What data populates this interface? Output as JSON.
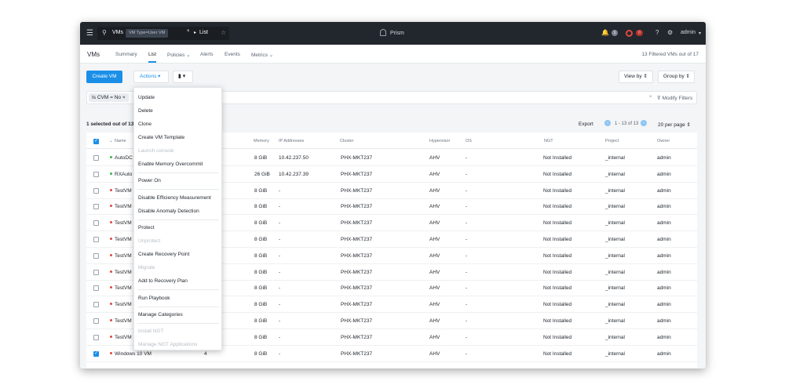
{
  "topbar": {
    "menu_icon": "hamburger-icon",
    "search_scope": "VMs",
    "search_tag": "VM Type=User VM",
    "search_tag_close": "×",
    "search_arrow": "▸",
    "search_view": "List",
    "brand": "Prism",
    "alerts_count": "1",
    "tasks_count": "0",
    "help": "?",
    "user": "admin"
  },
  "subnav": {
    "title": "VMs",
    "tabs": [
      {
        "label": "Summary"
      },
      {
        "label": "List"
      },
      {
        "label": "Policies ⌄"
      },
      {
        "label": "Alerts"
      },
      {
        "label": "Events"
      },
      {
        "label": "Metrics ⌄"
      }
    ],
    "filtered_text": "13 Filtered VMs out of 17"
  },
  "toolbar": {
    "create": "Create VM",
    "actions": "Actions ▾",
    "bookmark": "▮ ▾",
    "view_by": "View by ⇕",
    "group_by": "Group by ⇕"
  },
  "filter": {
    "chip": "Is CVM = No  ×",
    "clear": "×",
    "modify": "⊽ Modify Filters"
  },
  "summary": {
    "selected": "1 selected out of 13",
    "export": "Export",
    "pager_prev": "‹",
    "range": "1 - 13 of 13",
    "pager_next": "›",
    "per_page": "20 per page ⇕"
  },
  "columns": {
    "name": "Name",
    "memory": "Memory",
    "ip": "IP Addresses",
    "cluster": "Cluster",
    "hypervisor": "Hypervisor",
    "os": "OS",
    "ngt": "NGT",
    "project": "Project",
    "owner": "Owner"
  },
  "rows": [
    {
      "name": "AutoDC",
      "status": "on",
      "vcpu": "",
      "memory": "8 GiB",
      "ip": "10.42.237.50",
      "cluster": "PHX-MKT237",
      "hypervisor": "AHV",
      "os": "-",
      "ngt": "Not Installed",
      "project": "_internal",
      "owner": "admin",
      "checked": false
    },
    {
      "name": "RXAuto",
      "status": "on",
      "vcpu": "",
      "memory": "26 GiB",
      "ip": "10.42.237.39",
      "cluster": "PHX-MKT237",
      "hypervisor": "AHV",
      "os": "-",
      "ngt": "Not Installed",
      "project": "_internal",
      "owner": "admin",
      "checked": false
    },
    {
      "name": "TestVM",
      "status": "off",
      "vcpu": "",
      "memory": "8 GiB",
      "ip": "-",
      "cluster": "PHX-MKT237",
      "hypervisor": "AHV",
      "os": "-",
      "ngt": "Not Installed",
      "project": "_internal",
      "owner": "admin",
      "checked": false
    },
    {
      "name": "TestVM",
      "status": "off",
      "vcpu": "",
      "memory": "8 GiB",
      "ip": "-",
      "cluster": "PHX-MKT237",
      "hypervisor": "AHV",
      "os": "-",
      "ngt": "Not Installed",
      "project": "_internal",
      "owner": "admin",
      "checked": false
    },
    {
      "name": "TestVM",
      "status": "off",
      "vcpu": "",
      "memory": "8 GiB",
      "ip": "-",
      "cluster": "PHX-MKT237",
      "hypervisor": "AHV",
      "os": "-",
      "ngt": "Not Installed",
      "project": "_internal",
      "owner": "admin",
      "checked": false
    },
    {
      "name": "TestVM",
      "status": "off",
      "vcpu": "",
      "memory": "8 GiB",
      "ip": "-",
      "cluster": "PHX-MKT237",
      "hypervisor": "AHV",
      "os": "-",
      "ngt": "Not Installed",
      "project": "_internal",
      "owner": "admin",
      "checked": false
    },
    {
      "name": "TestVM",
      "status": "off",
      "vcpu": "",
      "memory": "8 GiB",
      "ip": "-",
      "cluster": "PHX-MKT237",
      "hypervisor": "AHV",
      "os": "-",
      "ngt": "Not Installed",
      "project": "_internal",
      "owner": "admin",
      "checked": false
    },
    {
      "name": "TestVM",
      "status": "off",
      "vcpu": "",
      "memory": "8 GiB",
      "ip": "-",
      "cluster": "PHX-MKT237",
      "hypervisor": "AHV",
      "os": "-",
      "ngt": "Not Installed",
      "project": "_internal",
      "owner": "admin",
      "checked": false
    },
    {
      "name": "TestVM",
      "status": "off",
      "vcpu": "",
      "memory": "8 GiB",
      "ip": "-",
      "cluster": "PHX-MKT237",
      "hypervisor": "AHV",
      "os": "-",
      "ngt": "Not Installed",
      "project": "_internal",
      "owner": "admin",
      "checked": false
    },
    {
      "name": "TestVM",
      "status": "off",
      "vcpu": "",
      "memory": "8 GiB",
      "ip": "-",
      "cluster": "PHX-MKT237",
      "hypervisor": "AHV",
      "os": "-",
      "ngt": "Not Installed",
      "project": "_internal",
      "owner": "admin",
      "checked": false
    },
    {
      "name": "TestVM",
      "status": "off",
      "vcpu": "",
      "memory": "8 GiB",
      "ip": "-",
      "cluster": "PHX-MKT237",
      "hypervisor": "AHV",
      "os": "-",
      "ngt": "Not Installed",
      "project": "_internal",
      "owner": "admin",
      "checked": false
    },
    {
      "name": "TestVM",
      "status": "off",
      "vcpu": "",
      "memory": "8 GiB",
      "ip": "-",
      "cluster": "PHX-MKT237",
      "hypervisor": "AHV",
      "os": "-",
      "ngt": "Not Installed",
      "project": "_internal",
      "owner": "admin",
      "checked": false
    },
    {
      "name": "Windows 10 VM",
      "status": "off",
      "vcpu": "4",
      "memory": "8 GiB",
      "ip": "-",
      "cluster": "PHX-MKT237",
      "hypervisor": "AHV",
      "os": "-",
      "ngt": "Not Installed",
      "project": "_internal",
      "owner": "admin",
      "checked": true
    }
  ],
  "actions_menu": [
    {
      "label": "Update",
      "disabled": false
    },
    {
      "label": "Delete",
      "disabled": false
    },
    {
      "label": "Clone",
      "disabled": false
    },
    {
      "label": "Create VM Template",
      "disabled": false
    },
    {
      "label": "Launch console",
      "disabled": true
    },
    {
      "label": "Enable Memory Overcommit",
      "disabled": false,
      "sep_after": true
    },
    {
      "label": "Power On",
      "disabled": false,
      "sep_after": true
    },
    {
      "label": "Disable Efficiency Measurement",
      "disabled": false
    },
    {
      "label": "Disable Anomaly Detection",
      "disabled": false,
      "sep_after": true
    },
    {
      "label": "Protect",
      "disabled": false
    },
    {
      "label": "Unprotect",
      "disabled": true
    },
    {
      "label": "Create Recovery Point",
      "disabled": false
    },
    {
      "label": "Migrate",
      "disabled": true
    },
    {
      "label": "Add to Recovery Plan",
      "disabled": false,
      "sep_after": true
    },
    {
      "label": "Run Playbook",
      "disabled": false,
      "sep_after": true
    },
    {
      "label": "Manage Categories",
      "disabled": false,
      "sep_after": true
    },
    {
      "label": "Install NGT",
      "disabled": true
    },
    {
      "label": "Manage NGT Applications",
      "disabled": true
    }
  ],
  "colors": {
    "accent": "#1b8fe8",
    "topbar": "#22272e",
    "status_off": "#e0483e",
    "status_on": "#3bb54a"
  }
}
